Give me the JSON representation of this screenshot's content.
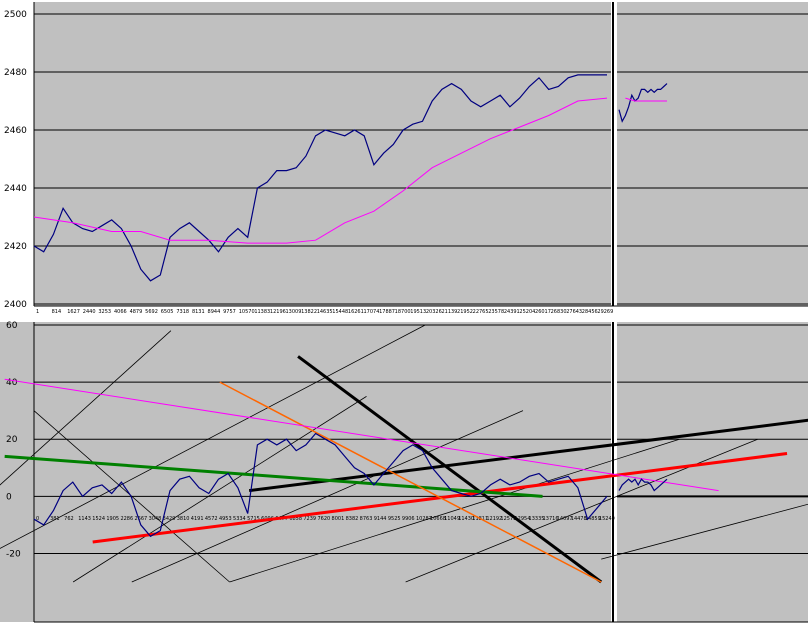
{
  "colors": {
    "plot_bg": "#c0c0c0",
    "page_bg": "#ffffff",
    "price": "#000080",
    "moving_average": "#ff00ff",
    "grid": "#000000",
    "trend_black": "#000000",
    "trend_red": "#ff0000",
    "trend_green": "#008000",
    "trend_orange": "#ff6600",
    "trend_magenta": "#ff00ff"
  },
  "chart_data": [
    {
      "type": "line",
      "title": "",
      "xlabel": "",
      "ylabel": "",
      "ylim": [
        2400,
        2500
      ],
      "y_ticks": [
        "2500",
        "2480",
        "2460",
        "2440",
        "2420",
        "2400"
      ],
      "x_tick_labels": [
        "1",
        "814",
        "1627",
        "2440",
        "3253",
        "4066",
        "4879",
        "5692",
        "6505",
        "7318",
        "8131",
        "8944",
        "9757",
        "10570",
        "11383",
        "12196",
        "13009",
        "13822",
        "14635",
        "15448",
        "16261",
        "17074",
        "17887",
        "18700",
        "19513",
        "20326",
        "21139",
        "21952",
        "22765",
        "23578",
        "24391",
        "25204",
        "26017",
        "26830",
        "27643",
        "28456",
        "29269"
      ],
      "grid": true,
      "series": [
        {
          "color_key": "price",
          "x": [
            0,
            1,
            2,
            3,
            4,
            5,
            6,
            7,
            8,
            9,
            10,
            11,
            12,
            13,
            14,
            15,
            16,
            17,
            18,
            19,
            20,
            21,
            22,
            23,
            24,
            25,
            26,
            27,
            28,
            29,
            30,
            31,
            32,
            33,
            34,
            35,
            36,
            37,
            38,
            39,
            40,
            41,
            42,
            43,
            44,
            45,
            46,
            47,
            48,
            49,
            50,
            51,
            52,
            53,
            54,
            55,
            56,
            57,
            58,
            59,
            60,
            61,
            62,
            63,
            64,
            65,
            66,
            67,
            68,
            69,
            70,
            71,
            72,
            73,
            74,
            75
          ],
          "values": [
            2420,
            2418,
            2424,
            2433,
            2428,
            2426,
            2425,
            2427,
            2429,
            2426,
            2420,
            2412,
            2408,
            2410,
            2423,
            2426,
            2428,
            2425,
            2422,
            2418,
            2423,
            2426,
            2423,
            2440,
            2442,
            2446,
            2446,
            2447,
            2451,
            2458,
            2460,
            2459,
            2458,
            2460,
            2458,
            2448,
            2452,
            2455,
            2460,
            2462,
            2463,
            2470,
            2474,
            2476,
            2474,
            2470,
            2468,
            2470,
            2472,
            2468,
            2471,
            2475,
            2478,
            2474,
            2475,
            2478,
            2479,
            2479,
            2479,
            2479,
            2467,
            2463,
            2465,
            2468,
            2472,
            2470,
            2471,
            2474,
            2474,
            2473,
            2474,
            2473,
            2474,
            2474,
            2475,
            2476
          ]
        },
        {
          "color_key": "moving_average",
          "x": [
            0,
            4,
            8,
            11,
            14,
            18,
            22,
            24,
            26,
            29,
            32,
            35,
            38,
            41,
            44,
            47,
            50,
            53,
            56,
            59,
            62,
            65,
            68,
            71,
            73,
            75
          ],
          "values": [
            2430,
            2428,
            2425,
            2425,
            2422,
            2422,
            2421,
            2421,
            2421,
            2422,
            2428,
            2432,
            2439,
            2447,
            2452,
            2457,
            2461,
            2465,
            2470,
            2471,
            2471,
            2470,
            2470,
            2470,
            2470,
            2470
          ]
        }
      ]
    },
    {
      "type": "line",
      "title": "",
      "xlabel": "",
      "ylabel": "",
      "ylim": [
        -30,
        60
      ],
      "y_ticks": [
        "60",
        "40",
        "20",
        "0",
        "-20"
      ],
      "x_tick_labels": [
        "0",
        "381",
        "762",
        "1143",
        "1524",
        "1905",
        "2286",
        "2667",
        "3048",
        "3429",
        "3810",
        "4191",
        "4572",
        "4953",
        "5334",
        "5715",
        "6096",
        "6477",
        "6858",
        "7239",
        "7620",
        "8001",
        "8382",
        "8763",
        "9144",
        "9525",
        "9906",
        "10287",
        "10668",
        "11049",
        "11430",
        "11811",
        "12192",
        "12573",
        "12954",
        "13335",
        "13716",
        "14097",
        "14478",
        "14859",
        "15240"
      ],
      "grid": true,
      "series": [
        {
          "color_key": "price",
          "x": [
            0,
            1,
            2,
            3,
            4,
            5,
            6,
            7,
            8,
            9,
            10,
            11,
            12,
            13,
            14,
            15,
            16,
            17,
            18,
            19,
            20,
            21,
            22,
            23,
            24,
            25,
            26,
            27,
            28,
            29,
            30,
            31,
            32,
            33,
            34,
            35,
            36,
            37,
            38,
            39,
            40,
            41,
            42,
            43,
            44,
            45,
            46,
            47,
            48,
            49,
            50,
            51,
            52,
            53,
            54,
            55,
            56,
            57,
            58,
            59,
            60,
            61,
            62,
            63,
            64,
            65,
            66,
            67,
            68,
            69,
            70,
            71,
            72,
            73,
            74,
            75
          ],
          "values": [
            -8,
            -10,
            -5,
            2,
            5,
            0,
            3,
            4,
            1,
            5,
            0,
            -10,
            -14,
            -12,
            2,
            6,
            7,
            3,
            1,
            6,
            8,
            3,
            -6,
            18,
            20,
            18,
            20,
            16,
            18,
            22,
            20,
            18,
            14,
            10,
            8,
            4,
            8,
            12,
            16,
            18,
            16,
            10,
            6,
            2,
            1,
            0,
            1,
            4,
            6,
            4,
            5,
            7,
            8,
            5,
            6,
            7,
            3,
            -8,
            -4,
            0,
            2,
            4,
            5,
            6,
            5,
            6,
            4,
            6,
            5,
            5,
            4,
            2,
            3,
            4,
            5,
            6
          ]
        }
      ],
      "trend_lines": [
        {
          "color_key": "trend_black",
          "points": [
            [
              22,
              2
            ],
            [
              80,
              27
            ]
          ]
        },
        {
          "color_key": "trend_black",
          "points": [
            [
              27,
              49
            ],
            [
              58,
              -30
            ]
          ]
        },
        {
          "color_key": "trend_red",
          "points": [
            [
              6,
              -16
            ],
            [
              77,
              15
            ]
          ]
        },
        {
          "color_key": "trend_green",
          "points": [
            [
              -3,
              14
            ],
            [
              52,
              0
            ]
          ]
        },
        {
          "color_key": "trend_orange",
          "points": [
            [
              19,
              40
            ],
            [
              58,
              -30
            ]
          ]
        },
        {
          "color_key": "trend_magenta",
          "points": [
            [
              -3,
              41
            ],
            [
              70,
              2
            ]
          ]
        }
      ]
    }
  ]
}
